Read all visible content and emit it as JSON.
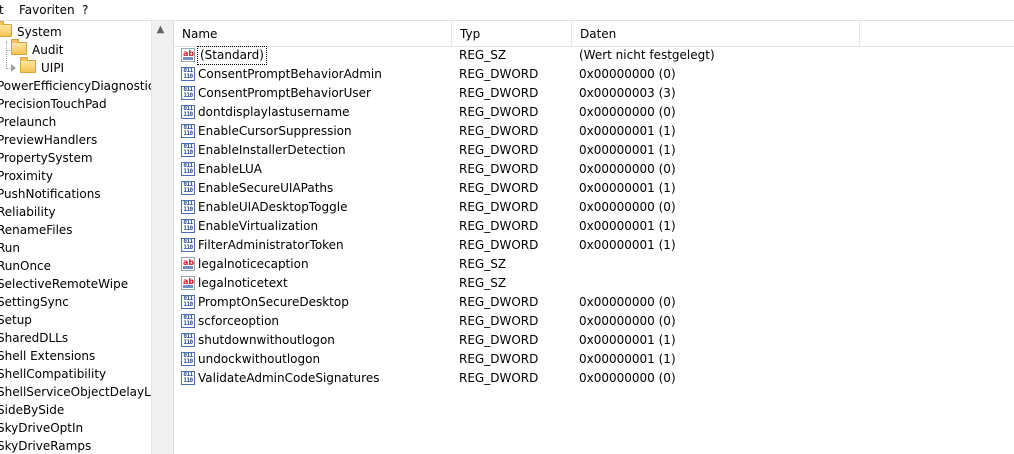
{
  "menu": [
    "t",
    "Favoriten",
    "?"
  ],
  "tree": {
    "items": [
      {
        "label": "System",
        "indent": "top",
        "folder": true
      },
      {
        "label": "Audit",
        "indent": "child",
        "folder": true
      },
      {
        "label": "UIPI",
        "indent": "child",
        "folder": true,
        "expander": true
      },
      {
        "label": "PowerEfficiencyDiagnostics"
      },
      {
        "label": "PrecisionTouchPad"
      },
      {
        "label": "Prelaunch"
      },
      {
        "label": "PreviewHandlers"
      },
      {
        "label": "PropertySystem"
      },
      {
        "label": "Proximity"
      },
      {
        "label": "PushNotifications"
      },
      {
        "label": "Reliability"
      },
      {
        "label": "RenameFiles"
      },
      {
        "label": "Run"
      },
      {
        "label": "RunOnce"
      },
      {
        "label": "SelectiveRemoteWipe"
      },
      {
        "label": "SettingSync"
      },
      {
        "label": "Setup"
      },
      {
        "label": "SharedDLLs"
      },
      {
        "label": "Shell Extensions"
      },
      {
        "label": "ShellCompatibility"
      },
      {
        "label": "ShellServiceObjectDelayLoad"
      },
      {
        "label": "SideBySide"
      },
      {
        "label": "SkyDriveOptIn"
      },
      {
        "label": "SkyDriveRamps"
      }
    ]
  },
  "columns": {
    "name": "Name",
    "type": "Typ",
    "data": "Daten"
  },
  "rows": [
    {
      "icon": "string-value-icon",
      "name": "(Standard)",
      "type": "REG_SZ",
      "data": "(Wert nicht festgelegt)",
      "selected": true
    },
    {
      "icon": "dword-value-icon",
      "name": "ConsentPromptBehaviorAdmin",
      "type": "REG_DWORD",
      "data": "0x00000000 (0)"
    },
    {
      "icon": "dword-value-icon",
      "name": "ConsentPromptBehaviorUser",
      "type": "REG_DWORD",
      "data": "0x00000003 (3)"
    },
    {
      "icon": "dword-value-icon",
      "name": "dontdisplaylastusername",
      "type": "REG_DWORD",
      "data": "0x00000000 (0)"
    },
    {
      "icon": "dword-value-icon",
      "name": "EnableCursorSuppression",
      "type": "REG_DWORD",
      "data": "0x00000001 (1)"
    },
    {
      "icon": "dword-value-icon",
      "name": "EnableInstallerDetection",
      "type": "REG_DWORD",
      "data": "0x00000001 (1)"
    },
    {
      "icon": "dword-value-icon",
      "name": "EnableLUA",
      "type": "REG_DWORD",
      "data": "0x00000000 (0)"
    },
    {
      "icon": "dword-value-icon",
      "name": "EnableSecureUIAPaths",
      "type": "REG_DWORD",
      "data": "0x00000001 (1)"
    },
    {
      "icon": "dword-value-icon",
      "name": "EnableUIADesktopToggle",
      "type": "REG_DWORD",
      "data": "0x00000000 (0)"
    },
    {
      "icon": "dword-value-icon",
      "name": "EnableVirtualization",
      "type": "REG_DWORD",
      "data": "0x00000001 (1)"
    },
    {
      "icon": "dword-value-icon",
      "name": "FilterAdministratorToken",
      "type": "REG_DWORD",
      "data": "0x00000001 (1)"
    },
    {
      "icon": "string-value-icon",
      "name": "legalnoticecaption",
      "type": "REG_SZ",
      "data": ""
    },
    {
      "icon": "string-value-icon",
      "name": "legalnoticetext",
      "type": "REG_SZ",
      "data": ""
    },
    {
      "icon": "dword-value-icon",
      "name": "PromptOnSecureDesktop",
      "type": "REG_DWORD",
      "data": "0x00000000 (0)"
    },
    {
      "icon": "dword-value-icon",
      "name": "scforceoption",
      "type": "REG_DWORD",
      "data": "0x00000000 (0)"
    },
    {
      "icon": "dword-value-icon",
      "name": "shutdownwithoutlogon",
      "type": "REG_DWORD",
      "data": "0x00000001 (1)"
    },
    {
      "icon": "dword-value-icon",
      "name": "undockwithoutlogon",
      "type": "REG_DWORD",
      "data": "0x00000001 (1)"
    },
    {
      "icon": "dword-value-icon",
      "name": "ValidateAdminCodeSignatures",
      "type": "REG_DWORD",
      "data": "0x00000000 (0)"
    }
  ],
  "icons": {
    "string_glyph": "ab",
    "dword_glyph": "011\n110",
    "scroll_up": "▲"
  }
}
